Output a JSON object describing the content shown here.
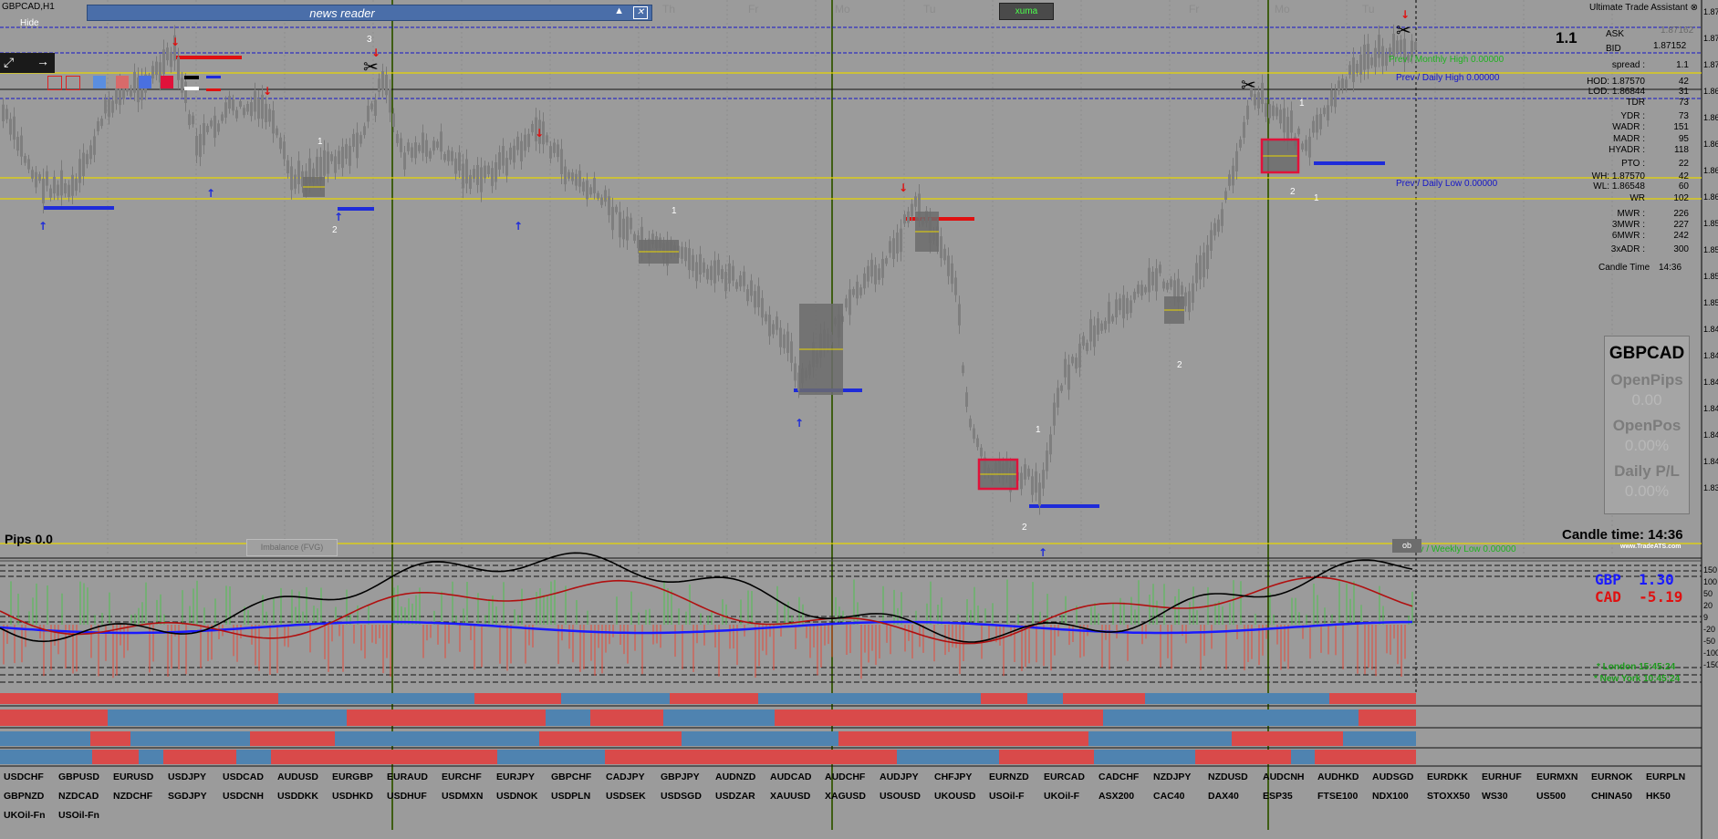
{
  "window": {
    "symbol_title": "GBPCAD,H1",
    "hide_label": "Hide"
  },
  "news_reader": {
    "title": "news reader",
    "collapse_icon": "▲",
    "close_icon": "✕"
  },
  "xuma_button": {
    "label": "xuma"
  },
  "uta": {
    "title": "Ultimate Trade Assistant",
    "close_icon": "⊗"
  },
  "days": [
    "Th",
    "Fr",
    "Mo",
    "Tu",
    "Fr",
    "Mo",
    "Tu"
  ],
  "levels": {
    "prev_monthly_high": "Prev / Monthly High 0.00000",
    "prev_daily_high": "Prev / Daily High 0.00000",
    "prev_daily_low": "Prev / Daily Low 0.00000",
    "prev_weekly_low": "Prev / Weekly Low 0.00000"
  },
  "level_colors": {
    "daily": "#1515c8",
    "monthly": "#1fb31f",
    "yellow": "#e8d600",
    "blue_line": "#1e2bd9",
    "red_line": "#e01010"
  },
  "swing_numbers": [
    "3",
    "1",
    "2",
    "1",
    "2",
    "1",
    "2",
    "1",
    "2",
    "1",
    "3"
  ],
  "stats": {
    "spread_big": "1.1",
    "ask_label": "ASK",
    "ask_value": "1.87162",
    "bid_label": "BID",
    "bid_value": "1.87152",
    "rows": [
      {
        "k": "spread :",
        "v": "1.1"
      },
      {
        "k": "HOD: 1.87570",
        "v": "42"
      },
      {
        "k": "LOD: 1.86844",
        "v": "31"
      },
      {
        "k": "TDR",
        "v": "73"
      },
      {
        "k": "YDR :",
        "v": "73"
      },
      {
        "k": "WADR :",
        "v": "151"
      },
      {
        "k": "MADR :",
        "v": "95"
      },
      {
        "k": "HYADR :",
        "v": "118"
      },
      {
        "k": "PTO :",
        "v": "22"
      },
      {
        "k": "WH: 1.87570",
        "v": "42"
      },
      {
        "k": "WL: 1.86548",
        "v": "60"
      },
      {
        "k": "WR",
        "v": "102"
      },
      {
        "k": "MWR :",
        "v": "226"
      },
      {
        "k": "3MWR :",
        "v": "227"
      },
      {
        "k": "6MWR :",
        "v": "242"
      },
      {
        "k": "3xADR :",
        "v": "300"
      }
    ],
    "candle_time_label": "Candle Time",
    "candle_time_value": "14:36"
  },
  "account_box": {
    "symbol": "GBPCAD",
    "open_pips_label": "OpenPips",
    "open_pips_value": "0.00",
    "open_pos_label": "OpenPos",
    "open_pos_value": "0.00%",
    "daily_pl_label": "Daily P/L",
    "daily_pl_value": "0.00%"
  },
  "pips_label": "Pips 0.0",
  "candle_time_big": "Candle time:  14:36",
  "trade_link": "www.TradeATS.com",
  "fvg_button": "Imbalance (FVG)",
  "ob_button": "ob",
  "price_axis": [
    "1.87",
    "1.87",
    "1.87",
    "1.86",
    "1.86",
    "1.86",
    "1.86",
    "1.86",
    "1.85",
    "1.85",
    "1.85",
    "1.85",
    "1.84",
    "1.84",
    "1.84",
    "1.84",
    "1.84",
    "1.84",
    "1.83"
  ],
  "currency_strength": {
    "gbp_label": "GBP",
    "gbp_value": "1.30",
    "cad_label": "CAD",
    "cad_value": "-5.19",
    "gbp_color": "#1a1aff",
    "cad_color": "#e01010"
  },
  "osc_axis": [
    "150",
    "100",
    "50",
    "20",
    "9",
    "-20",
    "-50",
    "-100",
    "-150"
  ],
  "sessions": {
    "london": "* London   15:45:24",
    "new_york": "* New York  10:45:24"
  },
  "pairs": [
    [
      "USDCHF",
      "GBPUSD",
      "EURUSD",
      "USDJPY",
      "USDCAD",
      "AUDUSD",
      "EURGBP",
      "EURAUD",
      "EURCHF",
      "EURJPY",
      "GBPCHF",
      "CADJPY",
      "GBPJPY",
      "AUDNZD",
      "AUDCAD",
      "AUDCHF",
      "AUDJPY",
      "CHFJPY",
      "EURNZD",
      "EURCAD",
      "CADCHF",
      "NZDJPY",
      "NZDUSD",
      "AUDCNH",
      "AUDHKD",
      "AUDSGD",
      "EURDKK",
      "EURHUF",
      "EURMXN",
      "EURNOK",
      "EURPLN"
    ],
    [
      "GBPNZD",
      "NZDCAD",
      "NZDCHF",
      "SGDJPY",
      "USDCNH",
      "USDDKK",
      "USDHKD",
      "USDHUF",
      "USDMXN",
      "USDNOK",
      "USDPLN",
      "USDSEK",
      "USDSGD",
      "USDZAR",
      "XAUUSD",
      "XAGUSD",
      "USOUSD",
      "UKOUSD",
      "USOil-F",
      "UKOil-F",
      "ASX200",
      "CAC40",
      "DAX40",
      "ESP35",
      "FTSE100",
      "NDX100",
      "STOXX50",
      "WS30",
      "US500",
      "CHINA50",
      "HK50"
    ],
    [
      "UKOil-Fn",
      "USOil-Fn"
    ]
  ]
}
